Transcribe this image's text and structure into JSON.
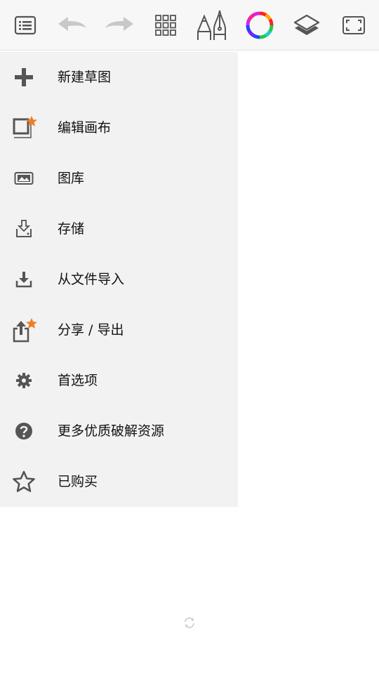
{
  "toolbar": {
    "buttons": [
      {
        "icon": "list-icon",
        "enabled": true
      },
      {
        "icon": "undo-icon",
        "enabled": false
      },
      {
        "icon": "redo-icon",
        "enabled": false
      },
      {
        "icon": "grid-icon",
        "enabled": true
      },
      {
        "icon": "brushes-icon",
        "enabled": true
      },
      {
        "icon": "color-wheel-icon",
        "enabled": true
      },
      {
        "icon": "layers-icon",
        "enabled": true
      },
      {
        "icon": "fullscreen-icon",
        "enabled": true
      }
    ]
  },
  "menu": {
    "items": [
      {
        "label": "新建草图",
        "icon": "plus-icon",
        "premium": false
      },
      {
        "label": "编辑画布",
        "icon": "edit-canvas-icon",
        "premium": true
      },
      {
        "label": "图库",
        "icon": "gallery-icon",
        "premium": false
      },
      {
        "label": "存储",
        "icon": "save-icon",
        "premium": false
      },
      {
        "label": "从文件导入",
        "icon": "import-icon",
        "premium": false
      },
      {
        "label": "分享 / 导出",
        "icon": "share-icon",
        "premium": true
      },
      {
        "label": "首选项",
        "icon": "gear-icon",
        "premium": false
      },
      {
        "label": "更多优质破解资源",
        "icon": "help-icon",
        "premium": false
      },
      {
        "label": "已购买",
        "icon": "star-outline-icon",
        "premium": false
      }
    ]
  },
  "colors": {
    "icon": "#555555",
    "icon_disabled": "#c8c8c8",
    "premium_star": "#f07d22",
    "menu_bg": "#f2f2f2",
    "toolbar_bg": "#f7f7f7"
  }
}
